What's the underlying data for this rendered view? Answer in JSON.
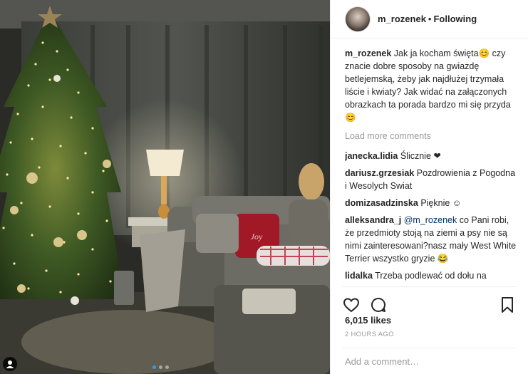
{
  "header": {
    "username": "m_rozenek",
    "separator": "•",
    "follow_status": "Following"
  },
  "caption": {
    "username": "m_rozenek",
    "text": "Jak ja kocham święta😊 czy znacie dobre sposoby na gwiazdę betlejemską, żeby jak najdłużej trzymała liście i kwiaty? Jak widać na załączonych obrazkach ta porada bardzo mi się przyda 😊"
  },
  "load_more": "Load more comments",
  "comments": [
    {
      "username": "janecka.lidia",
      "text": "Ślicznie ❤"
    },
    {
      "username": "dariusz.grzesiak",
      "text": "Pozdrowienia z Pogodna i Wesolych Swiat"
    },
    {
      "username": "domizasadzinska",
      "text": "Pięknie ☺"
    },
    {
      "username": "alleksandra_j",
      "mention": "@m_rozenek",
      "text": "co Pani robi, że przedmioty stoją na ziemi a psy nie są nimi zainteresowani?nasz mały West White Terrier wszystko gryzie 😂"
    },
    {
      "username": "lidalka",
      "text": "Trzeba podlewać od dołu na spodek niech pije wodę a nie z góry do ziemii.Będzie stała do wielkanocy.😉"
    }
  ],
  "likes": "6,015 likes",
  "timestamp": "2 HOURS AGO",
  "add_comment_placeholder": "Add a comment…",
  "carousel": {
    "count": 3,
    "active_index": 0
  },
  "colors": {
    "link_blue": "#3897f0",
    "mention": "#003569",
    "muted": "#999999",
    "border": "#efefef"
  }
}
